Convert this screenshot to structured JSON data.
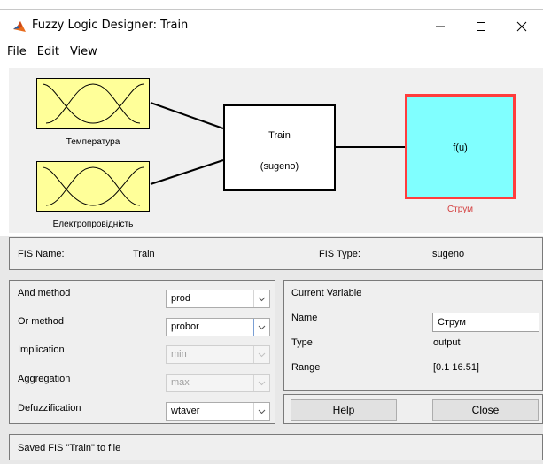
{
  "window": {
    "title": "Fuzzy Logic Designer: Train",
    "controls": {
      "minimize": "—",
      "maximize": "☐",
      "close": "✕"
    }
  },
  "menu": [
    "File",
    "Edit",
    "View"
  ],
  "diagram": {
    "inputs": [
      {
        "label": "Температура"
      },
      {
        "label": "Електропровідність"
      }
    ],
    "system": {
      "name": "Train",
      "type": "(sugeno)"
    },
    "output": {
      "function": "f(u)",
      "label": "Струм"
    },
    "colors": {
      "input_box": "#ffff99",
      "output_box": "#80ffff",
      "output_border": "#ff3d3d",
      "output_label": "#d44040"
    }
  },
  "fis": {
    "name_label": "FIS Name:",
    "name_value": "Train",
    "type_label": "FIS Type:",
    "type_value": "sugeno"
  },
  "methods": [
    {
      "label": "And method",
      "value": "prod",
      "enabled": true
    },
    {
      "label": "Or method",
      "value": "probor",
      "enabled": true
    },
    {
      "label": "Implication",
      "value": "min",
      "enabled": false
    },
    {
      "label": "Aggregation",
      "value": "max",
      "enabled": false
    },
    {
      "label": "Defuzzification",
      "value": "wtaver",
      "enabled": true
    }
  ],
  "current_variable": {
    "header": "Current Variable",
    "name_label": "Name",
    "name_value": "Струм",
    "type_label": "Type",
    "type_value": "output",
    "range_label": "Range",
    "range_value": "[0.1 16.51]"
  },
  "buttons": {
    "help": "Help",
    "close": "Close"
  },
  "status": "Saved FIS \"Train\" to file"
}
